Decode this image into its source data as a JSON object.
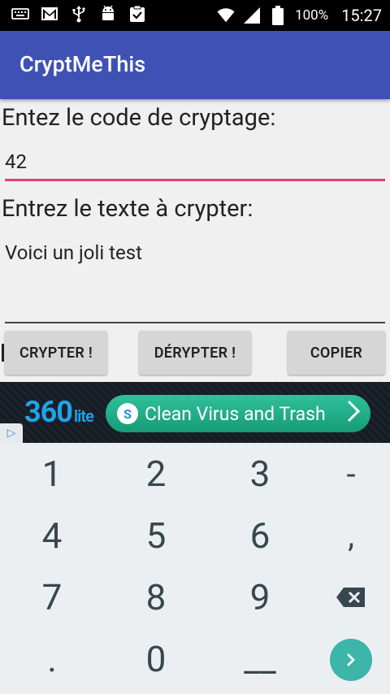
{
  "status_bar": {
    "battery": "100%",
    "time": "15:27",
    "left_icons": [
      "keyboard-icon",
      "gmail-icon",
      "usb-icon",
      "android-icon",
      "clipboard-check-icon"
    ],
    "right_icons": [
      "wifi-icon",
      "signal-icon",
      "battery-icon"
    ]
  },
  "app_bar": {
    "title": "CryptMeThis",
    "color": "#3f51b5"
  },
  "form": {
    "code_label": "Entez le code de cryptage:",
    "code_value": "42",
    "text_label": "Entrez le texte à crypter:",
    "text_value": "Voici un joli test",
    "accent_color": "#e0407e"
  },
  "buttons": {
    "crypt": "CRYPTER !",
    "decrypt": "DÉRYPTER !",
    "copy": "COPIER"
  },
  "ad": {
    "logo_main": "360",
    "logo_suffix": "lite",
    "cta": "Clean Virus and Trash",
    "cta_arrow": ">",
    "shield_glyph": "S",
    "choice_glyph": "▷"
  },
  "keypad": {
    "row1": [
      "1",
      "2",
      "3",
      "-"
    ],
    "row2": [
      "4",
      "5",
      "6",
      ","
    ],
    "row3": [
      "7",
      "8",
      "9"
    ],
    "row4": [
      ".",
      "0",
      "__"
    ],
    "accent": "#3bb6a8"
  }
}
